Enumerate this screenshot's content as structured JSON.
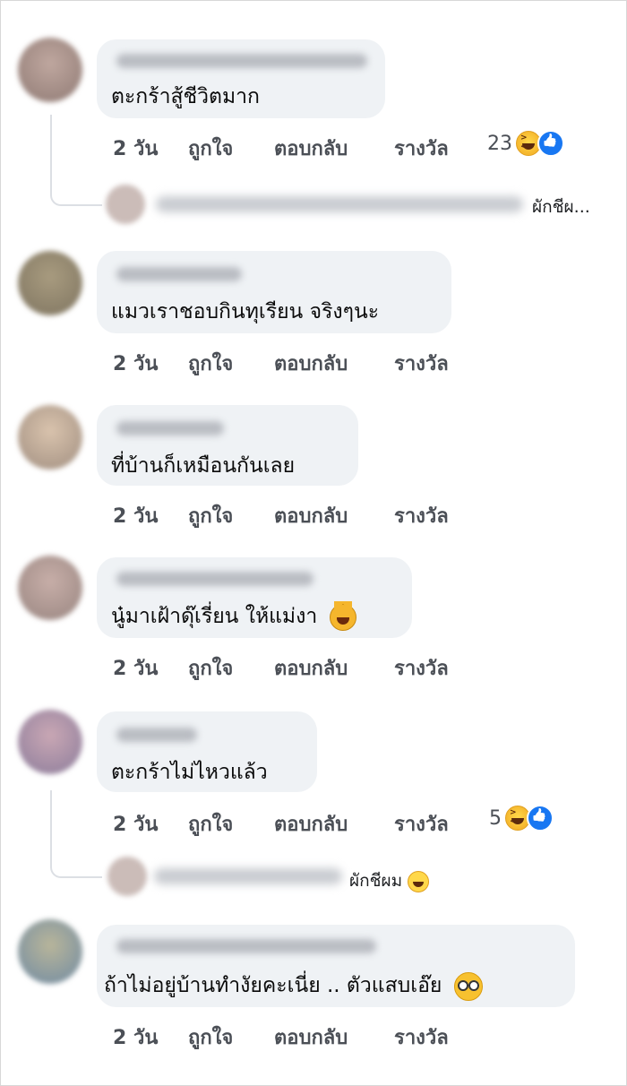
{
  "comments": [
    {
      "text": "ตะกร้าสู้ชีวิตมาก",
      "actions": {
        "time": "2 วัน",
        "like": "ถูกใจ",
        "reply": "ตอบกลับ",
        "award": "รางวัล"
      },
      "reaction_count": "23",
      "reply_preview": "ผักชีผ..."
    },
    {
      "text": "แมวเราชอบกินทุเรียน จริงๆนะ",
      "actions": {
        "time": "2 วัน",
        "like": "ถูกใจ",
        "reply": "ตอบกลับ",
        "award": "รางวัล"
      }
    },
    {
      "text": "ที่บ้านก็เหมือนกันเลย",
      "actions": {
        "time": "2 วัน",
        "like": "ถูกใจ",
        "reply": "ตอบกลับ",
        "award": "รางวัล"
      }
    },
    {
      "text": "นู๋มาเฝ้าดุ๊เรี่ยน ให้แม่งา",
      "actions": {
        "time": "2 วัน",
        "like": "ถูกใจ",
        "reply": "ตอบกลับ",
        "award": "รางวัล"
      }
    },
    {
      "text": "ตะกร้าไม่ไหวแล้ว",
      "actions": {
        "time": "2 วัน",
        "like": "ถูกใจ",
        "reply": "ตอบกลับ",
        "award": "รางวัล"
      },
      "reaction_count": "5",
      "reply_preview": "ผักชีผม"
    },
    {
      "text": "ถ้าไม่อยู่บ้านทำงัยคะเนี่ย .. ตัวแสบเอ๊ย",
      "actions": {
        "time": "2 วัน",
        "like": "ถูกใจ",
        "reply": "ตอบกลับ",
        "award": "รางวัล"
      }
    }
  ],
  "icons": {
    "laugh": "laughing-emoji",
    "like": "like-reaction",
    "cat": "crying-laughing-cat-emoji",
    "sweat": "grinning-sweat-emoji",
    "glasses": "nerd-glasses-emoji"
  },
  "colors": {
    "bubble": "#eff2f5",
    "like_blue": "#1877f2",
    "meta_text": "#4b4f56"
  }
}
